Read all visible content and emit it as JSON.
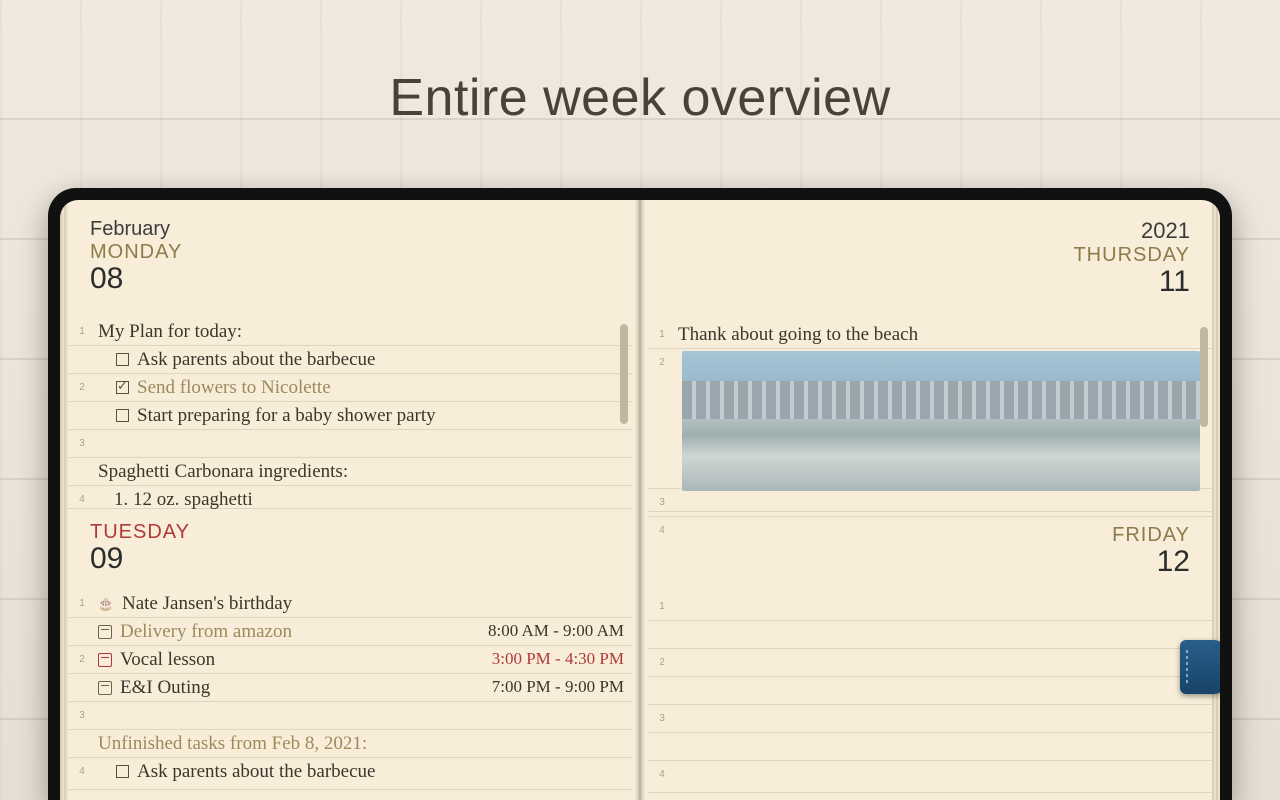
{
  "heading": "Entire week overview",
  "left": {
    "month": "February",
    "days": [
      {
        "weekday": "MONDAY",
        "daynum": "08",
        "entries": [
          {
            "num": "1",
            "type": "text",
            "text": "My Plan for today:"
          },
          {
            "num": "",
            "type": "todo",
            "checked": false,
            "text": "Ask parents about the barbecue"
          },
          {
            "num": "2",
            "type": "todo",
            "checked": true,
            "text": "Send flowers to Nicolette"
          },
          {
            "num": "",
            "type": "todo",
            "checked": false,
            "text": "Start preparing for a baby shower party"
          },
          {
            "num": "3",
            "type": "blank"
          },
          {
            "num": "",
            "type": "text",
            "text": "Spaghetti Carbonara ingredients:"
          },
          {
            "num": "4",
            "type": "text",
            "text": "1. 12 oz. spaghetti",
            "indent": true
          }
        ]
      },
      {
        "weekday": "TUESDAY",
        "weekday_red": true,
        "daynum": "09",
        "entries": [
          {
            "num": "1",
            "type": "event-cake",
            "text": "Nate Jansen's birthday"
          },
          {
            "num": "",
            "type": "event-cal",
            "text": "Delivery from amazon",
            "muted": true,
            "time": "8:00 AM - 9:00 AM"
          },
          {
            "num": "2",
            "type": "event-cal-red",
            "text": "Vocal lesson",
            "time": "3:00 PM - 4:30 PM",
            "time_red": true
          },
          {
            "num": "",
            "type": "event-cal",
            "text": "E&I Outing",
            "time": "7:00 PM - 9:00 PM"
          },
          {
            "num": "3",
            "type": "blank"
          },
          {
            "num": "",
            "type": "text",
            "text": "Unfinished tasks from Feb 8, 2021:",
            "muted": true
          },
          {
            "num": "4",
            "type": "todo",
            "checked": false,
            "text": "Ask parents about the barbecue"
          }
        ]
      }
    ]
  },
  "right": {
    "year": "2021",
    "days": [
      {
        "weekday": "THURSDAY",
        "daynum": "11",
        "entries": [
          {
            "num": "1",
            "type": "text",
            "text": "Thank about going to the beach"
          },
          {
            "num": "2",
            "type": "photo"
          },
          {
            "num": "3",
            "type": "blank"
          },
          {
            "num": "4",
            "type": "blank"
          }
        ],
        "tall": true
      },
      {
        "weekday": "FRIDAY",
        "daynum": "12",
        "entries": [
          {
            "num": "1",
            "type": "blank"
          },
          {
            "num": "",
            "type": "blank"
          },
          {
            "num": "2",
            "type": "blank"
          },
          {
            "num": "",
            "type": "blank"
          },
          {
            "num": "3",
            "type": "blank"
          },
          {
            "num": "",
            "type": "blank"
          },
          {
            "num": "4",
            "type": "blank"
          }
        ]
      }
    ]
  }
}
